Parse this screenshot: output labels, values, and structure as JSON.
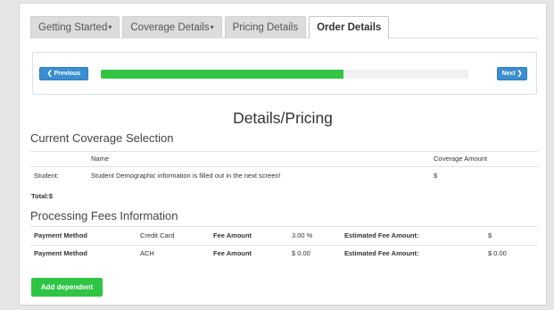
{
  "tabs": [
    {
      "label": "Getting Started",
      "dropdown": true,
      "active": false
    },
    {
      "label": "Coverage Details",
      "dropdown": true,
      "active": false
    },
    {
      "label": "Pricing Details",
      "dropdown": false,
      "active": false
    },
    {
      "label": "Order Details",
      "dropdown": false,
      "active": true
    }
  ],
  "progress": {
    "previous_label": "Previous",
    "next_label": "Next",
    "fraction": 0.66,
    "fill_color": "#31c543"
  },
  "page_title": "Details/Pricing",
  "coverage": {
    "title": "Current Coverage Selection",
    "headers": {
      "name": "Name",
      "amount": "Coverage Amount"
    },
    "row": {
      "label": "Student:",
      "name": "Student Demographic information is filled out in the next screen!",
      "amount": "$"
    },
    "total": "Total:$"
  },
  "fees": {
    "title": "Processing Fees Information",
    "rows": [
      {
        "method_label": "Payment Method",
        "method": "Credit Card",
        "fee_label": "Fee Amount",
        "fee": "3.00 %",
        "est_label": "Estimated Fee Amount:",
        "est": "$"
      },
      {
        "method_label": "Payment Method",
        "method": "ACH",
        "fee_label": "Fee Amount",
        "fee": "$ 0.00",
        "est_label": "Estimated Fee Amount:",
        "est": "$ 0.00"
      }
    ]
  },
  "add_dependent_label": "Add dependent",
  "colors": {
    "primary": "#3a8fd4",
    "success": "#2fc544"
  }
}
